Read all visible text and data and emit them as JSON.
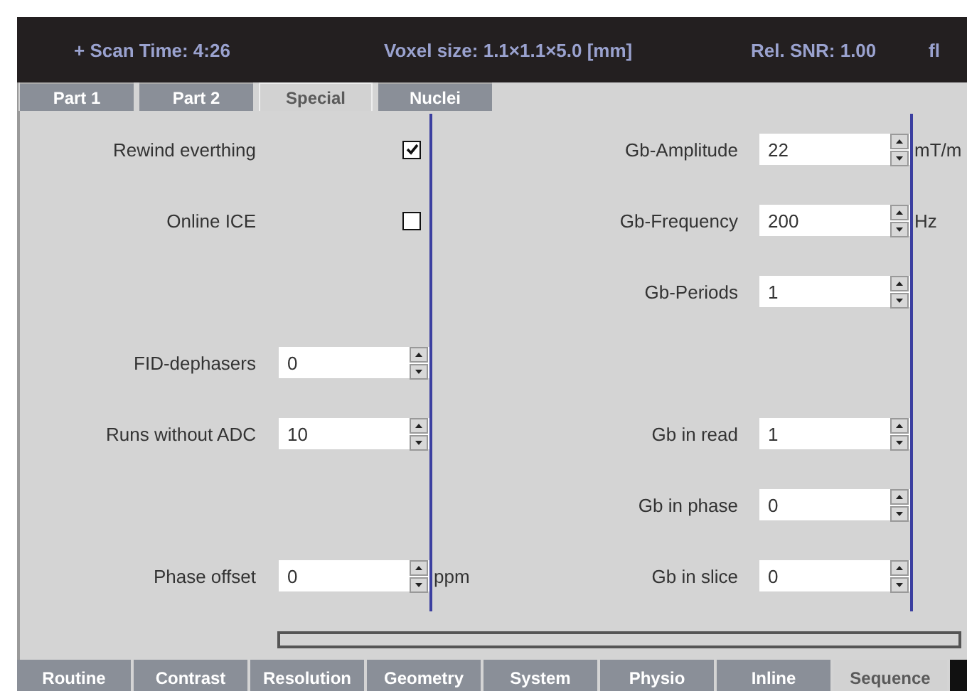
{
  "header": {
    "scan_time": "+ Scan Time: 4:26",
    "voxel_size": "Voxel size: 1.1×1.1×5.0 [mm]",
    "snr": "Rel. SNR: 1.00",
    "extra": "fl"
  },
  "top_tabs": [
    {
      "label": "Part 1",
      "selected": false
    },
    {
      "label": "Part 2",
      "selected": false
    },
    {
      "label": "Special",
      "selected": true
    },
    {
      "label": "Nuclei",
      "selected": false
    }
  ],
  "columns": [
    {
      "rows": [
        {
          "kind": "checkbox",
          "label": "Rewind everthing",
          "checked": true
        },
        {
          "kind": "checkbox",
          "label": "Online ICE",
          "checked": false
        },
        {
          "kind": "blank"
        },
        {
          "kind": "spinner",
          "label": "FID-dephasers",
          "value": "0"
        },
        {
          "kind": "spinner",
          "label": "Runs without ADC",
          "value": "10"
        },
        {
          "kind": "blank"
        },
        {
          "kind": "spinner",
          "label": "Phase offset",
          "value": "0",
          "unit": "ppm"
        }
      ]
    },
    {
      "rows": [
        {
          "kind": "spinner",
          "label": "Gb-Amplitude",
          "value": "22",
          "unit": "mT/m"
        },
        {
          "kind": "spinner",
          "label": "Gb-Frequency",
          "value": "200",
          "unit": "Hz"
        },
        {
          "kind": "spinner",
          "label": "Gb-Periods",
          "value": "1"
        },
        {
          "kind": "blank"
        },
        {
          "kind": "spinner",
          "label": "Gb in read",
          "value": "1"
        },
        {
          "kind": "spinner",
          "label": "Gb in phase",
          "value": "0"
        },
        {
          "kind": "spinner",
          "label": "Gb in slice",
          "value": "0"
        }
      ]
    }
  ],
  "bottom_tabs": [
    {
      "label": "Routine",
      "selected": false
    },
    {
      "label": "Contrast",
      "selected": false
    },
    {
      "label": "Resolution",
      "selected": false
    },
    {
      "label": "Geometry",
      "selected": false
    },
    {
      "label": "System",
      "selected": false
    },
    {
      "label": "Physio",
      "selected": false
    },
    {
      "label": "Inline",
      "selected": false
    },
    {
      "label": "Sequence",
      "selected": true
    }
  ]
}
